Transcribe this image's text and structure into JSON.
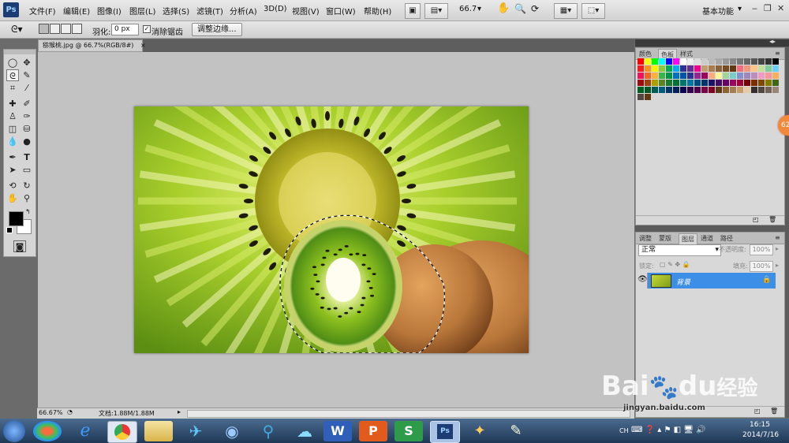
{
  "app": {
    "logo": "Ps",
    "workspace": "基本功能",
    "zoom_value": "66.7"
  },
  "menu": [
    "文件(F)",
    "编辑(E)",
    "图像(I)",
    "图层(L)",
    "选择(S)",
    "滤镜(T)",
    "分析(A)",
    "3D(D)",
    "视图(V)",
    "窗口(W)",
    "帮助(H)"
  ],
  "options": {
    "feather_label": "羽化:",
    "feather_value": "0 px",
    "antialias_label": "消除锯齿",
    "antialias_checked": true,
    "refine_edge_label": "调整边缘..."
  },
  "document": {
    "tab_title": "猕猴桃.jpg @ 66.7%(RGB/8#)",
    "close_glyph": "×"
  },
  "status": {
    "zoom": "66.67%",
    "doc_info": "文档:1.88M/1.88M"
  },
  "swatch_panel": {
    "tabs": [
      "颜色",
      "色板",
      "样式"
    ],
    "active": "色板"
  },
  "layers_panel": {
    "tabs": [
      "调整",
      "蒙版",
      "图层",
      "通道",
      "路径"
    ],
    "active": "图层",
    "blend_mode": "正常",
    "opacity_label": "不透明度:",
    "opacity_value": "100%",
    "lock_label": "锁定:",
    "fill_label": "填充:",
    "fill_value": "100%",
    "layers": [
      {
        "name": "背景",
        "locked": true,
        "visible": true
      }
    ]
  },
  "taskbar": {
    "time": "16:15",
    "date": "2014/7/16",
    "lang": "CH"
  },
  "badge": {
    "text": "62"
  },
  "watermark": {
    "brand": "Bai",
    "brand2": "du",
    "brand_cn": "经验",
    "url": "jingyan.baidu.com"
  },
  "colors": {
    "accent_layer": "#3d8ee6",
    "kiwi_green": "#8fc21f",
    "kiwi_brown": "#b9773a"
  }
}
